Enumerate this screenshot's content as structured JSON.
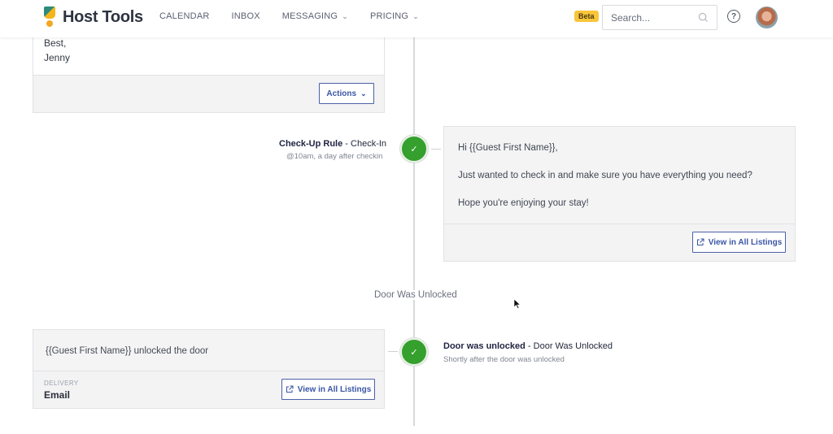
{
  "header": {
    "app_name": "Host Tools",
    "nav": [
      {
        "label": "CALENDAR",
        "has_dropdown": false
      },
      {
        "label": "INBOX",
        "has_dropdown": false
      },
      {
        "label": "MESSAGING",
        "has_dropdown": true
      },
      {
        "label": "PRICING",
        "has_dropdown": true
      }
    ],
    "beta_badge": "Beta",
    "search_placeholder": "Search...",
    "help_icon": "question-circle-icon",
    "avatar_icon": "user-avatar"
  },
  "colors": {
    "accent": "#3a56a6",
    "success": "#35a02d",
    "beta": "#f9c63b"
  },
  "timeline": {
    "prev_card": {
      "lines": [
        "Best,",
        "Jenny"
      ],
      "actions_label": "Actions",
      "actions_chevron": "⌄"
    },
    "checkup_rule": {
      "title": "Check-Up Rule",
      "separator": " - ",
      "trigger": "Check-In",
      "schedule": "@10am, a day after checkin",
      "status_icon": "check-icon",
      "message": {
        "line1": "Hi {{Guest First Name}},",
        "line2": "Just wanted to check in and make sure you have everything you need?",
        "line3": "Hope you're enjoying your stay!"
      },
      "view_button": "View in All Listings"
    },
    "section_label": "Door Was Unlocked",
    "door_rule": {
      "title": "Door was unlocked",
      "separator": " - ",
      "trigger": "Door Was Unlocked",
      "schedule": "Shortly after the door was unlocked",
      "status_icon": "check-icon",
      "message": "{{Guest First Name}} unlocked the door",
      "delivery_label": "DELIVERY",
      "delivery_value": "Email",
      "view_button": "View in All Listings"
    }
  }
}
